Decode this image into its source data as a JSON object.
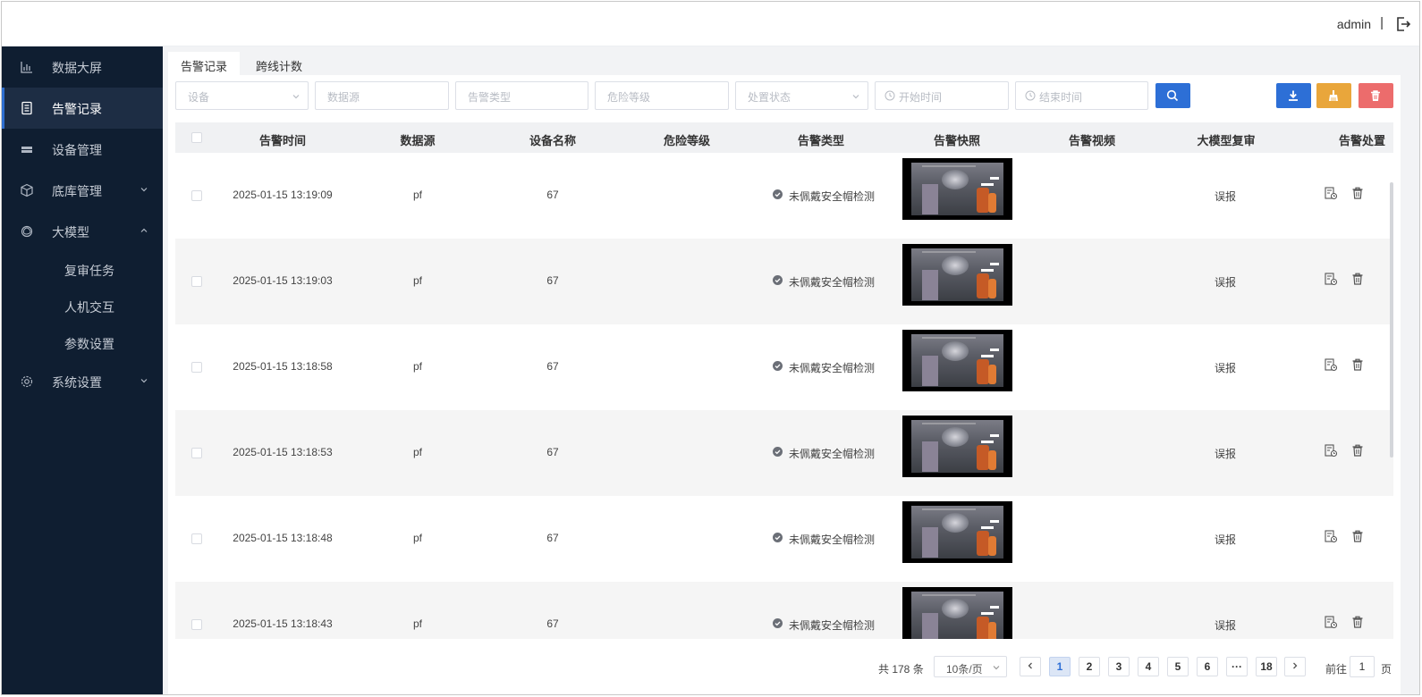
{
  "header": {
    "user": "admin",
    "divider": "|"
  },
  "sidebar": {
    "items": [
      {
        "label": "数据大屏",
        "icon": "bar-chart-icon"
      },
      {
        "label": "告警记录",
        "icon": "document-icon",
        "active": true
      },
      {
        "label": "设备管理",
        "icon": "device-icon"
      },
      {
        "label": "底库管理",
        "icon": "cube-icon",
        "expandable": true
      },
      {
        "label": "大模型",
        "icon": "ai-model-icon",
        "expandable": true,
        "expanded": true
      },
      {
        "label": "系统设置",
        "icon": "gear-icon",
        "expandable": true
      }
    ],
    "subitems": [
      {
        "label": "复审任务"
      },
      {
        "label": "人机交互"
      },
      {
        "label": "参数设置"
      }
    ]
  },
  "tabs": [
    {
      "label": "告警记录",
      "active": true
    },
    {
      "label": "跨线计数",
      "active": false
    }
  ],
  "filters": {
    "device": "设备",
    "source": "数据源",
    "alert_type": "告警类型",
    "level": "危险等级",
    "status": "处置状态",
    "start": "开始时间",
    "end": "结束时间"
  },
  "columns": [
    "告警时间",
    "数据源",
    "设备名称",
    "危险等级",
    "告警类型",
    "告警快照",
    "告警视频",
    "大模型复审",
    "告警处置"
  ],
  "rows": [
    {
      "time": "2025-01-15 13:19:09",
      "source": "pf",
      "device": "67",
      "level": "",
      "type": "未佩戴安全帽检测",
      "video": "",
      "review": "误报"
    },
    {
      "time": "2025-01-15 13:19:03",
      "source": "pf",
      "device": "67",
      "level": "",
      "type": "未佩戴安全帽检测",
      "video": "",
      "review": "误报"
    },
    {
      "time": "2025-01-15 13:18:58",
      "source": "pf",
      "device": "67",
      "level": "",
      "type": "未佩戴安全帽检测",
      "video": "",
      "review": "误报"
    },
    {
      "time": "2025-01-15 13:18:53",
      "source": "pf",
      "device": "67",
      "level": "",
      "type": "未佩戴安全帽检测",
      "video": "",
      "review": "误报"
    },
    {
      "time": "2025-01-15 13:18:48",
      "source": "pf",
      "device": "67",
      "level": "",
      "type": "未佩戴安全帽检测",
      "video": "",
      "review": "误报"
    },
    {
      "time": "2025-01-15 13:18:43",
      "source": "pf",
      "device": "67",
      "level": "",
      "type": "未佩戴安全帽检测",
      "video": "",
      "review": "误报"
    }
  ],
  "pagination": {
    "total": "共 178 条",
    "page_size": "10条/页",
    "pages": [
      "1",
      "2",
      "3",
      "4",
      "5",
      "6",
      "···",
      "18"
    ],
    "current": "1",
    "goto_prefix": "前往",
    "goto_value": "1",
    "goto_suffix": "页"
  },
  "colors": {
    "sidebar_bg": "#0f1e31",
    "primary": "#2d6fd6",
    "warning": "#e9a63b",
    "danger": "#ec6c6c"
  }
}
